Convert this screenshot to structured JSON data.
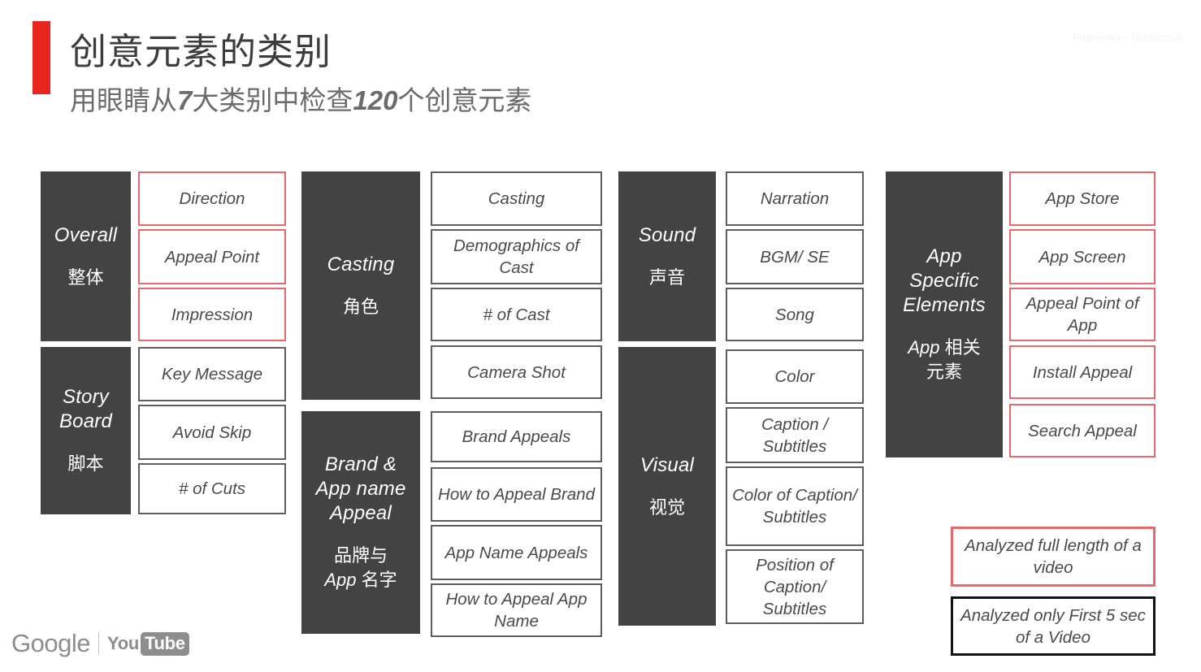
{
  "header": {
    "title": "创意元素的类别",
    "subtitle_pre": "用眼睛从",
    "subtitle_num1": "7",
    "subtitle_mid": "大类别中检查",
    "subtitle_num2": "120",
    "subtitle_post": "个创意元素",
    "confidential": "Proprietary + Confidential",
    "accent_color": "#e8241c"
  },
  "colors": {
    "category_bg": "#434343",
    "red_border": "#e4696b",
    "gray_border": "#5d5d5d",
    "black_border": "#111111"
  },
  "groups": [
    {
      "en": "Overall",
      "zh": "整体",
      "items": [
        {
          "label": "Direction",
          "border": "red"
        },
        {
          "label": "Appeal Point",
          "border": "red"
        },
        {
          "label": "Impression",
          "border": "red"
        }
      ]
    },
    {
      "en": "Story\nBoard",
      "en_line1": "Story",
      "en_line2": "Board",
      "zh": "脚本",
      "items": [
        {
          "label": "Key Message",
          "border": "gray"
        },
        {
          "label": "Avoid Skip",
          "border": "gray"
        },
        {
          "label": "# of Cuts",
          "border": "gray"
        }
      ]
    },
    {
      "en": "Casting",
      "zh": "角色",
      "items": [
        {
          "label": "Casting",
          "border": "gray"
        },
        {
          "label": "Demographics of Cast",
          "border": "gray"
        },
        {
          "label": "# of Cast",
          "border": "gray"
        },
        {
          "label": "Camera Shot",
          "border": "gray"
        }
      ]
    },
    {
      "en_line1": "Brand &",
      "en_line2": "App name",
      "en_line3": "Appeal",
      "zh_line1": "品牌与",
      "zh_line2_lat": "App",
      "zh_line2": " 名字",
      "items": [
        {
          "label": "Brand Appeals",
          "border": "gray"
        },
        {
          "label": "How to Appeal Brand",
          "border": "gray"
        },
        {
          "label": "App Name Appeals",
          "border": "gray"
        },
        {
          "label": "How to Appeal App Name",
          "border": "gray"
        }
      ]
    },
    {
      "en": "Sound",
      "zh": "声音",
      "items": [
        {
          "label": "Narration",
          "border": "gray"
        },
        {
          "label": "BGM/ SE",
          "border": "gray"
        },
        {
          "label": "Song",
          "border": "gray"
        }
      ]
    },
    {
      "en": "Visual",
      "zh": "视觉",
      "items": [
        {
          "label": "Color",
          "border": "gray"
        },
        {
          "label": "Caption / Subtitles",
          "border": "gray"
        },
        {
          "label": "Color of Caption/ Subtitles",
          "border": "gray"
        },
        {
          "label": "Position of Caption/ Subtitles",
          "border": "gray"
        }
      ]
    },
    {
      "en_line1": "App",
      "en_line2": "Specific",
      "en_line3": "Elements",
      "zh_line1_lat": "App",
      "zh_line1": " 相关",
      "zh_line2": "元素",
      "items": [
        {
          "label": "App Store",
          "border": "red"
        },
        {
          "label": "App Screen",
          "border": "red"
        },
        {
          "label": "Appeal Point of App",
          "border": "red"
        },
        {
          "label": "Install Appeal",
          "border": "red"
        },
        {
          "label": "Search Appeal",
          "border": "red"
        }
      ]
    }
  ],
  "legend": [
    {
      "label": "Analyzed full length of a video",
      "border": "red"
    },
    {
      "label": "Analyzed only First 5 sec of a Video",
      "border": "black"
    }
  ],
  "footer": {
    "google": "Google",
    "you": "You",
    "tube": "Tube"
  }
}
